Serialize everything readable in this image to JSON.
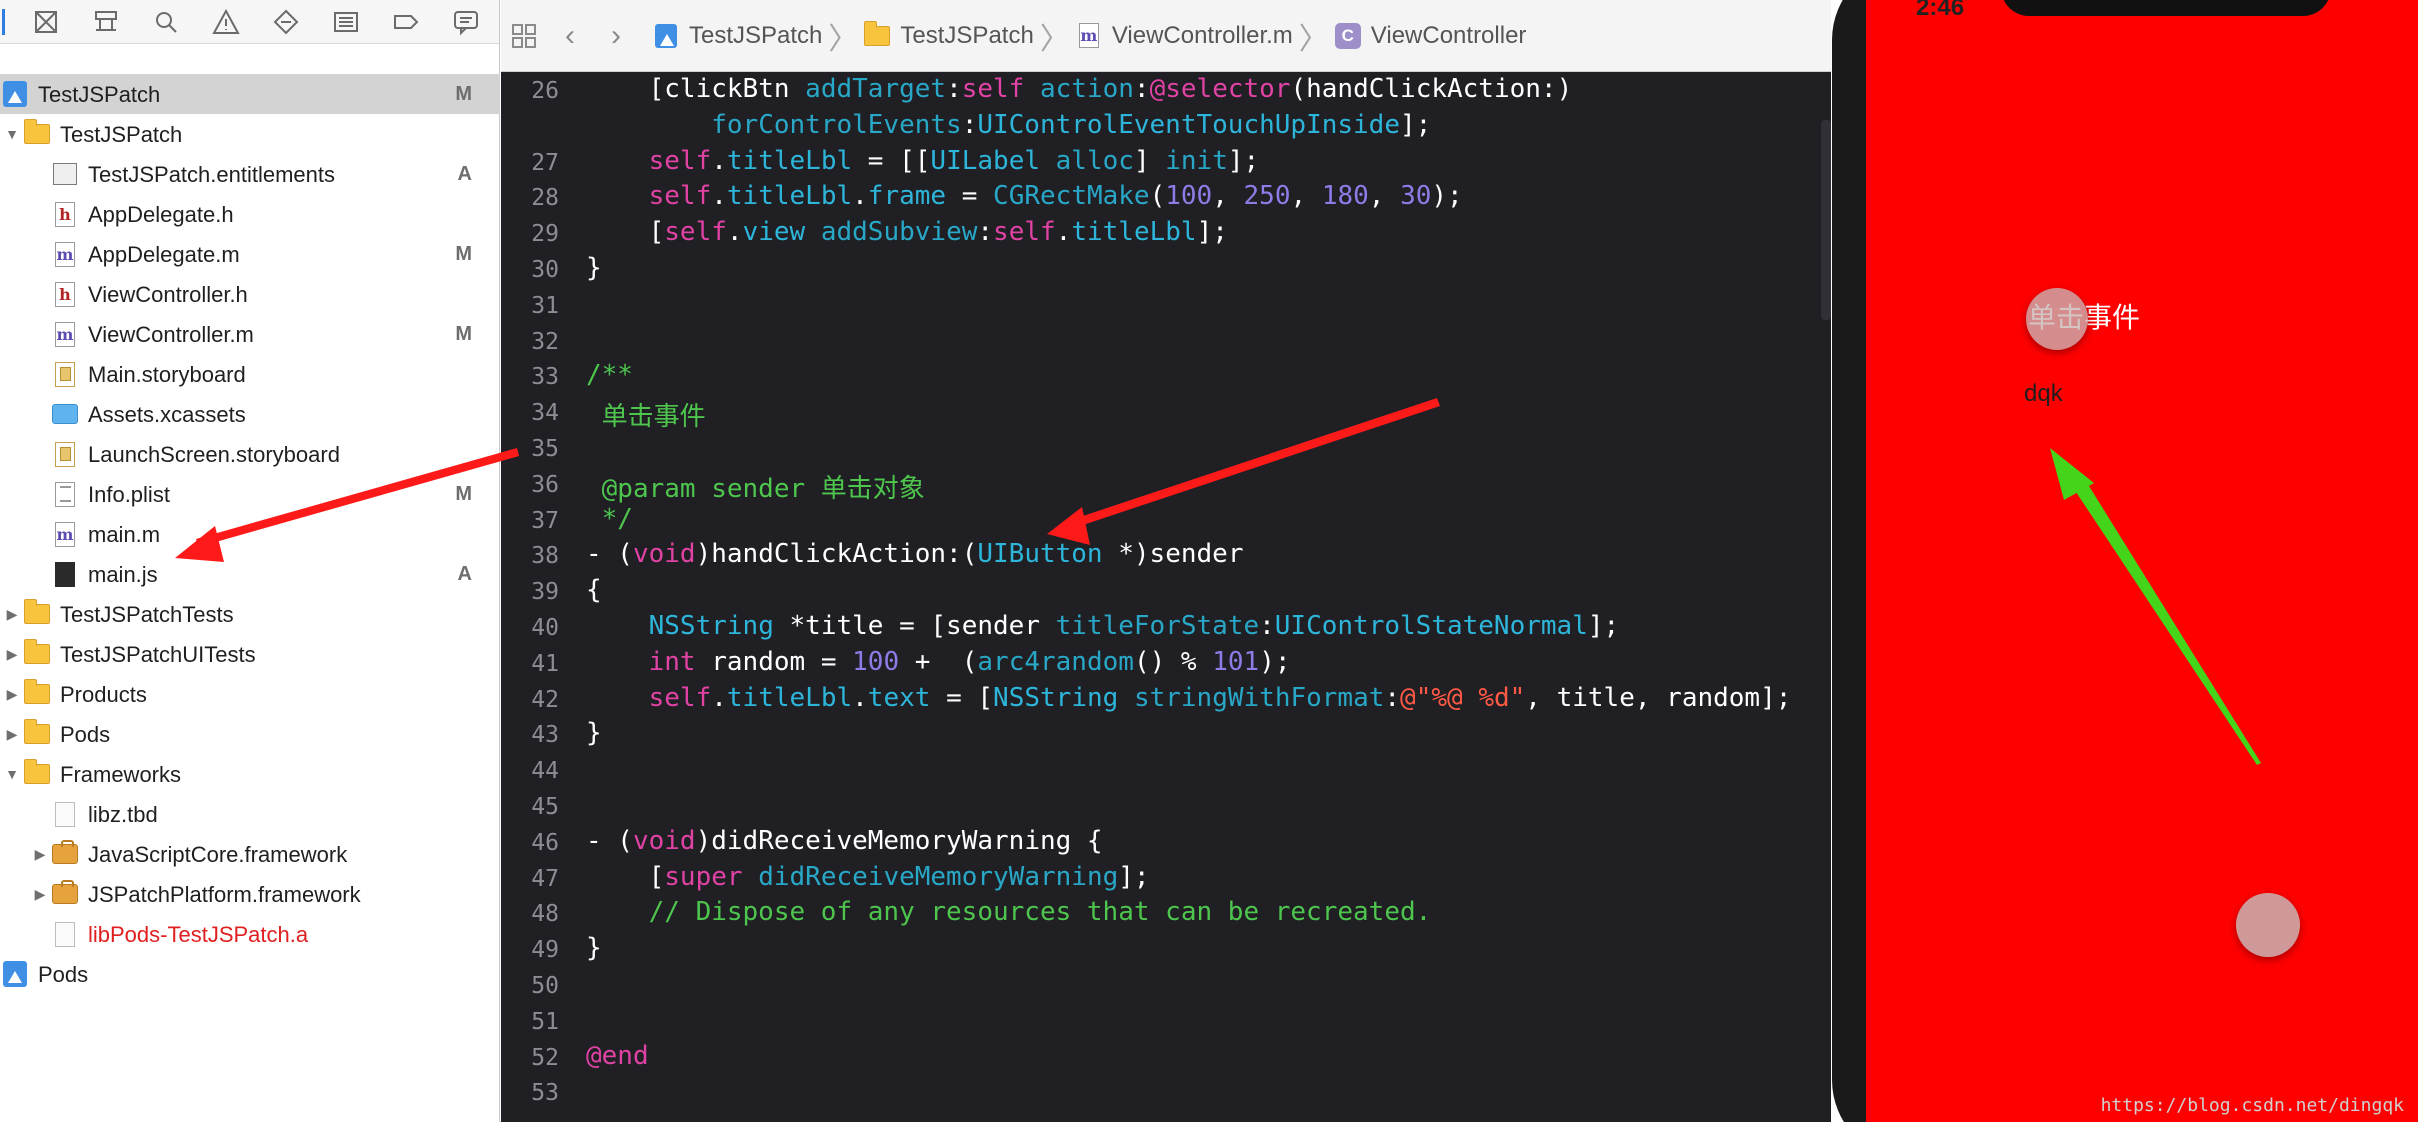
{
  "navigator": {
    "toolbar_icons": [
      "folder-x-icon",
      "hierarchy-icon",
      "search-icon",
      "warning-icon",
      "diamond-icon",
      "list-icon",
      "tag-icon",
      "comment-icon"
    ],
    "rows": [
      {
        "label": "TestJSPatch",
        "badge": "M",
        "icon": "project-icon",
        "bold": true
      },
      {
        "label": "TestJSPatch",
        "badge": "",
        "icon": "folder-icon"
      },
      {
        "label": "TestJSPatch.entitlements",
        "badge": "A",
        "icon": "entitlements-file-icon"
      },
      {
        "label": "AppDelegate.h",
        "badge": "",
        "icon": "h-file-icon"
      },
      {
        "label": "AppDelegate.m",
        "badge": "M",
        "icon": "m-file-icon"
      },
      {
        "label": "ViewController.h",
        "badge": "",
        "icon": "h-file-icon"
      },
      {
        "label": "ViewController.m",
        "badge": "M",
        "icon": "m-file-icon"
      },
      {
        "label": "Main.storyboard",
        "badge": "",
        "icon": "storyboard-icon"
      },
      {
        "label": "Assets.xcassets",
        "badge": "",
        "icon": "assets-icon"
      },
      {
        "label": "LaunchScreen.storyboard",
        "badge": "",
        "icon": "storyboard-icon"
      },
      {
        "label": "Info.plist",
        "badge": "M",
        "icon": "plist-icon"
      },
      {
        "label": "main.m",
        "badge": "",
        "icon": "m-file-icon"
      },
      {
        "label": "main.js",
        "badge": "A",
        "icon": "js-file-icon"
      },
      {
        "label": "TestJSPatchTests",
        "badge": "",
        "icon": "folder-icon"
      },
      {
        "label": "TestJSPatchUITests",
        "badge": "",
        "icon": "folder-icon"
      },
      {
        "label": "Products",
        "badge": "",
        "icon": "folder-icon"
      },
      {
        "label": "Pods",
        "badge": "",
        "icon": "folder-icon"
      },
      {
        "label": "Frameworks",
        "badge": "",
        "icon": "folder-icon"
      },
      {
        "label": "libz.tbd",
        "badge": "",
        "icon": "tbd-file-icon"
      },
      {
        "label": "JavaScriptCore.framework",
        "badge": "",
        "icon": "framework-icon"
      },
      {
        "label": "JSPatchPlatform.framework",
        "badge": "",
        "icon": "framework-icon"
      },
      {
        "label": "libPods-TestJSPatch.a",
        "badge": "",
        "icon": "library-icon",
        "color": "#e02020"
      },
      {
        "label": "Pods",
        "badge": "",
        "icon": "project-icon"
      }
    ]
  },
  "jumpbar": {
    "items": [
      "TestJSPatch",
      "TestJSPatch",
      "ViewController.m",
      "ViewController"
    ]
  },
  "code": {
    "lines": [
      {
        "n": "26",
        "tokens": [
          [
            "p",
            "    ["
          ],
          [
            "p",
            "clickBtn "
          ],
          [
            "f",
            "addTarget"
          ],
          [
            "p",
            ":"
          ],
          [
            "k",
            "self"
          ],
          [
            "p",
            " "
          ],
          [
            "f",
            "action"
          ],
          [
            "p",
            ":"
          ],
          [
            "a",
            "@selector"
          ],
          [
            "p",
            "(handClickAction:)"
          ]
        ]
      },
      {
        "n": "",
        "tokens": [
          [
            "p",
            "        "
          ],
          [
            "f",
            "forControlEvents"
          ],
          [
            "p",
            ":"
          ],
          [
            "t",
            "UIControlEventTouchUpInside"
          ],
          [
            "p",
            "];"
          ]
        ]
      },
      {
        "n": "27",
        "tokens": [
          [
            "p",
            "    "
          ],
          [
            "k",
            "self"
          ],
          [
            "p",
            "."
          ],
          [
            "t",
            "titleLbl"
          ],
          [
            "p",
            " = [["
          ],
          [
            "t",
            "UILabel"
          ],
          [
            "p",
            " "
          ],
          [
            "f",
            "alloc"
          ],
          [
            "p",
            "] "
          ],
          [
            "f",
            "init"
          ],
          [
            "p",
            "];"
          ]
        ]
      },
      {
        "n": "28",
        "tokens": [
          [
            "p",
            "    "
          ],
          [
            "k",
            "self"
          ],
          [
            "p",
            "."
          ],
          [
            "t",
            "titleLbl"
          ],
          [
            "p",
            "."
          ],
          [
            "t",
            "frame"
          ],
          [
            "p",
            " = "
          ],
          [
            "f",
            "CGRectMake"
          ],
          [
            "p",
            "("
          ],
          [
            "n",
            "100"
          ],
          [
            "p",
            ", "
          ],
          [
            "n",
            "250"
          ],
          [
            "p",
            ", "
          ],
          [
            "n",
            "180"
          ],
          [
            "p",
            ", "
          ],
          [
            "n",
            "30"
          ],
          [
            "p",
            ");"
          ]
        ]
      },
      {
        "n": "29",
        "tokens": [
          [
            "p",
            "    ["
          ],
          [
            "k",
            "self"
          ],
          [
            "p",
            "."
          ],
          [
            "t",
            "view"
          ],
          [
            "p",
            " "
          ],
          [
            "f",
            "addSubview"
          ],
          [
            "p",
            ":"
          ],
          [
            "k",
            "self"
          ],
          [
            "p",
            "."
          ],
          [
            "t",
            "titleLbl"
          ],
          [
            "p",
            "];"
          ]
        ]
      },
      {
        "n": "30",
        "tokens": [
          [
            "p",
            "}"
          ]
        ]
      },
      {
        "n": "31",
        "tokens": []
      },
      {
        "n": "32",
        "tokens": []
      },
      {
        "n": "33",
        "tokens": [
          [
            "c",
            "/**"
          ]
        ]
      },
      {
        "n": "34",
        "tokens": [
          [
            "c",
            " 单击事件"
          ]
        ]
      },
      {
        "n": "35",
        "tokens": []
      },
      {
        "n": "36",
        "tokens": [
          [
            "c",
            " @param sender 单击对象"
          ]
        ]
      },
      {
        "n": "37",
        "tokens": [
          [
            "c",
            " */"
          ]
        ]
      },
      {
        "n": "38",
        "tokens": [
          [
            "p",
            "- ("
          ],
          [
            "k",
            "void"
          ],
          [
            "p",
            ")handClickAction:("
          ],
          [
            "t",
            "UIButton"
          ],
          [
            "p",
            " *)sender"
          ]
        ]
      },
      {
        "n": "39",
        "tokens": [
          [
            "p",
            "{"
          ]
        ]
      },
      {
        "n": "40",
        "tokens": [
          [
            "p",
            "    "
          ],
          [
            "t",
            "NSString"
          ],
          [
            "p",
            " *title = [sender "
          ],
          [
            "f",
            "titleForState"
          ],
          [
            "p",
            ":"
          ],
          [
            "t",
            "UIControlStateNormal"
          ],
          [
            "p",
            "];"
          ]
        ]
      },
      {
        "n": "41",
        "tokens": [
          [
            "p",
            "    "
          ],
          [
            "k",
            "int"
          ],
          [
            "p",
            " random = "
          ],
          [
            "n",
            "100"
          ],
          [
            "p",
            " +  ("
          ],
          [
            "f",
            "arc4random"
          ],
          [
            "p",
            "() % "
          ],
          [
            "n",
            "101"
          ],
          [
            "p",
            ");"
          ]
        ]
      },
      {
        "n": "42",
        "tokens": [
          [
            "p",
            "    "
          ],
          [
            "k",
            "self"
          ],
          [
            "p",
            "."
          ],
          [
            "t",
            "titleLbl"
          ],
          [
            "p",
            "."
          ],
          [
            "t",
            "text"
          ],
          [
            "p",
            " = ["
          ],
          [
            "t",
            "NSString"
          ],
          [
            "p",
            " "
          ],
          [
            "f",
            "stringWithFormat"
          ],
          [
            "p",
            ":"
          ],
          [
            "s",
            "@\"%@ %d\""
          ],
          [
            "p",
            ", title, random];"
          ]
        ]
      },
      {
        "n": "43",
        "tokens": [
          [
            "p",
            "}"
          ]
        ]
      },
      {
        "n": "44",
        "tokens": []
      },
      {
        "n": "45",
        "tokens": []
      },
      {
        "n": "46",
        "tokens": [
          [
            "p",
            "- ("
          ],
          [
            "k",
            "void"
          ],
          [
            "p",
            ")didReceiveMemoryWarning {"
          ]
        ]
      },
      {
        "n": "47",
        "tokens": [
          [
            "p",
            "    ["
          ],
          [
            "k",
            "super"
          ],
          [
            "p",
            " "
          ],
          [
            "f",
            "didReceiveMemoryWarning"
          ],
          [
            "p",
            "];"
          ]
        ]
      },
      {
        "n": "48",
        "tokens": [
          [
            "c",
            "    // Dispose of any resources that can be recreated."
          ]
        ]
      },
      {
        "n": "49",
        "tokens": [
          [
            "p",
            "}"
          ]
        ]
      },
      {
        "n": "50",
        "tokens": []
      },
      {
        "n": "51",
        "tokens": []
      },
      {
        "n": "52",
        "tokens": [
          [
            "a",
            "@end"
          ]
        ]
      },
      {
        "n": "53",
        "tokens": []
      }
    ]
  },
  "simulator": {
    "status_time": "2:46",
    "button_label": "单击事件",
    "title_label": "dqk",
    "background_color": "#fe0000"
  },
  "annotations": {
    "arrow_colors": [
      "#ff1a1a",
      "#ff1a1a",
      "#44d41a"
    ]
  },
  "watermark": "https://blog.csdn.net/dingqk"
}
